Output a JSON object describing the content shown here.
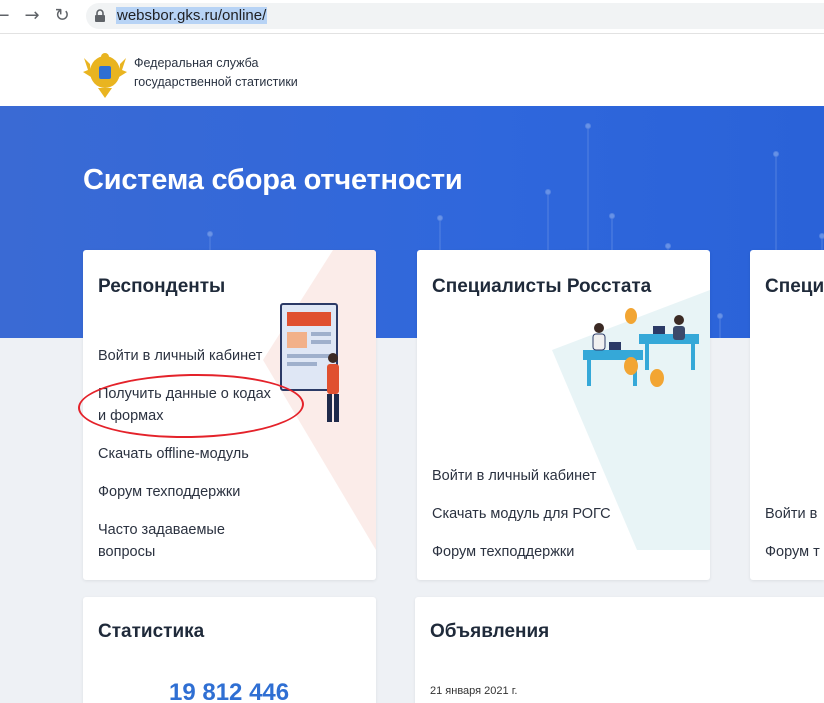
{
  "browser": {
    "back_glyph": "←",
    "forward_glyph": "→",
    "reload_glyph": "↻",
    "url": "websbor.gks.ru/online/"
  },
  "header": {
    "org_line1": "Федеральная служба",
    "org_line2": "государственной статистики"
  },
  "hero": {
    "title": "Система сбора отчетности"
  },
  "cards": {
    "respondents": {
      "title": "Респонденты",
      "links": [
        "Войти в личный кабинет",
        "Получить данные о кодах",
        "и формах",
        "Скачать offline-модуль",
        "Форум техподдержки",
        "Часто задаваемые",
        "вопросы"
      ]
    },
    "specialists": {
      "title": "Специалисты Росстата",
      "links": [
        "Войти в личный кабинет",
        "Скачать модуль для РОГС",
        "Форум техподдержки"
      ]
    },
    "third": {
      "title": "Специ",
      "links": [
        "Войти в",
        "Форум т"
      ]
    },
    "statistics": {
      "title": "Статистика",
      "number": "19 812 446"
    },
    "announcements": {
      "title": "Объявления",
      "date": "21 января 2021 г."
    }
  },
  "colors": {
    "hero_blue": "#2f67dc",
    "link_blue": "#2f6fd3",
    "annotation_red": "#e4222a"
  }
}
